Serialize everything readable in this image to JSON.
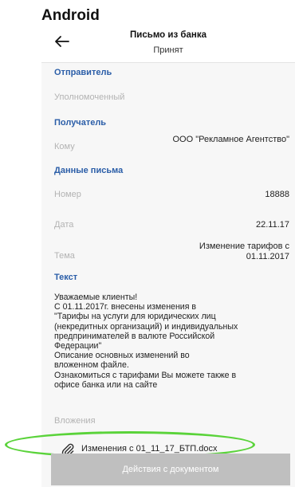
{
  "platform_label": "Android",
  "header": {
    "title": "Письмо из банка",
    "subtitle": "Принят"
  },
  "sections": {
    "sender": {
      "title": "Отправитель",
      "label": "Уполномоченный"
    },
    "recipient": {
      "title": "Получатель",
      "label": "Кому",
      "value": "ООО \"Рекламное Агентство\""
    },
    "letter_data": {
      "title": "Данные письма",
      "number_label": "Номер",
      "number_value": "18888",
      "date_label": "Дата",
      "date_value": "22.11.17",
      "subject_label": "Тема",
      "subject_value_line1": "Изменение тарифов с",
      "subject_value_line2": "01.11.2017"
    },
    "text": {
      "title": "Текст",
      "body": "Уважаемые клиенты!\nС 01.11.2017г. внесены изменения в\n\"Тарифы на услуги для юридических лиц\n(некредитных организаций) и индивидуальных\nпредпринимателей в валюте Российской\nФедерации\"\nОписание основных изменений во\nвложенном файле.\nОзнакомиться с тарифами Вы можете также в\nофисе банка или на сайте"
    },
    "attachments": {
      "label": "Вложения",
      "file_name": "Изменения с 01_11_17_БТП.docx"
    }
  },
  "action_button_label": "Действия с документом",
  "colors": {
    "section_title": "#2b5ea8",
    "highlight": "#5ad33a",
    "button_bg": "#bfbfbf"
  },
  "icons": {
    "back": "arrow-left-icon",
    "attachment": "paperclip-icon"
  }
}
